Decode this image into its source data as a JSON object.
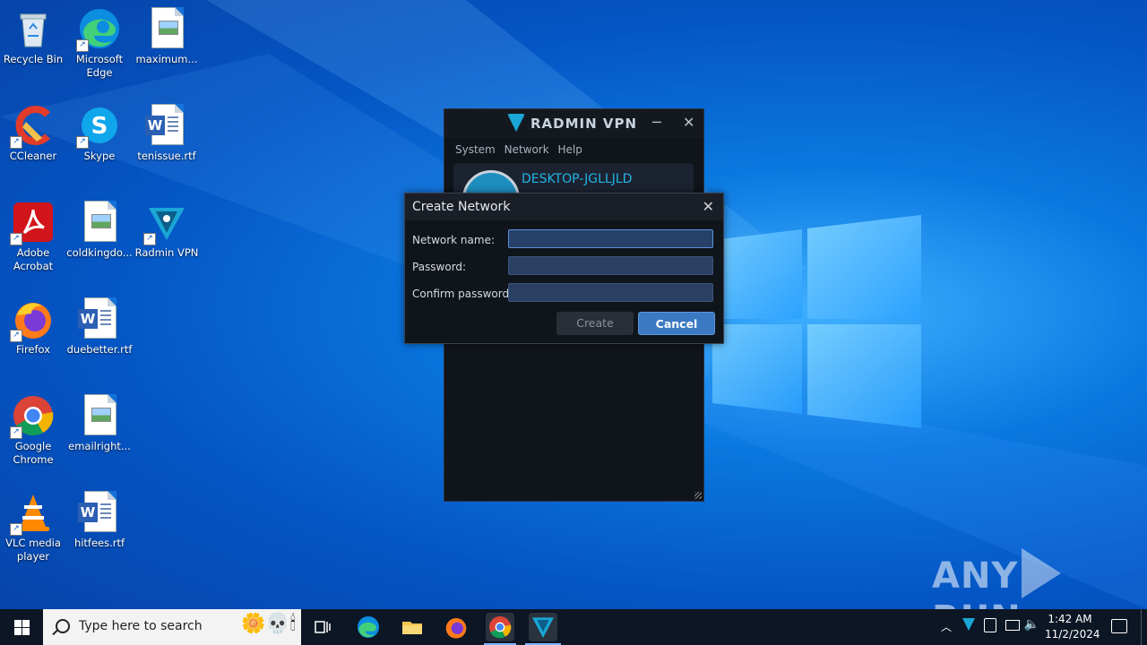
{
  "desktop_icons": [
    {
      "id": "recycle-bin",
      "label": "Recycle Bin"
    },
    {
      "id": "edge",
      "label": "Microsoft Edge"
    },
    {
      "id": "maximum",
      "label": "maximum..."
    },
    {
      "id": "ccleaner",
      "label": "CCleaner"
    },
    {
      "id": "skype",
      "label": "Skype"
    },
    {
      "id": "tenissue",
      "label": "tenissue.rtf"
    },
    {
      "id": "acrobat",
      "label": "Adobe Acrobat"
    },
    {
      "id": "coldking",
      "label": "coldkingdo..."
    },
    {
      "id": "radmin-desktop",
      "label": "Radmin VPN"
    },
    {
      "id": "firefox",
      "label": "Firefox"
    },
    {
      "id": "duebetter",
      "label": "duebetter.rtf"
    },
    {
      "id": "chrome",
      "label": "Google Chrome"
    },
    {
      "id": "emailright",
      "label": "emailright..."
    },
    {
      "id": "vlc",
      "label": "VLC media player"
    },
    {
      "id": "hitfees",
      "label": "hitfees.rtf"
    }
  ],
  "radmin_window": {
    "title": "RADMIN VPN",
    "menu": [
      "System",
      "Network",
      "Help"
    ],
    "hostname": "DESKTOP-JGLLJLD",
    "minimize": "─",
    "close": "✕"
  },
  "create_dialog": {
    "title": "Create Network",
    "close": "✕",
    "fields": [
      {
        "label": "Network name:",
        "value": ""
      },
      {
        "label": "Password:",
        "value": ""
      },
      {
        "label": "Confirm password:",
        "value": ""
      }
    ],
    "create_label": "Create",
    "cancel_label": "Cancel"
  },
  "watermark": {
    "left": "ANY",
    "right": "RUN"
  },
  "taskbar": {
    "search_placeholder": "Type here to search",
    "time": "1:42 AM",
    "date": "11/2/2024",
    "pinned": [
      "task-view",
      "edge",
      "file-explorer",
      "firefox",
      "chrome",
      "radmin-vpn"
    ]
  }
}
